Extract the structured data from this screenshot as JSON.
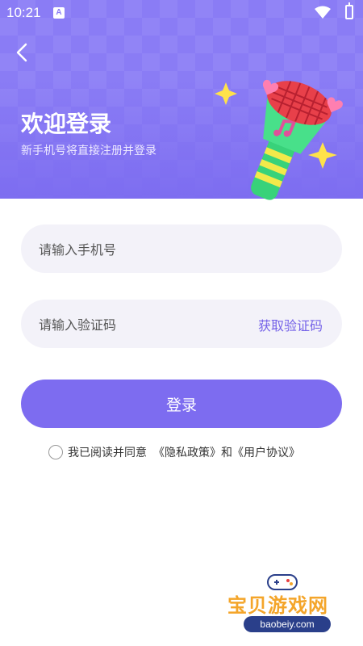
{
  "status_bar": {
    "time": "10:21",
    "notification_letter": "A"
  },
  "header": {
    "title": "欢迎登录",
    "subtitle": "新手机号将直接注册并登录"
  },
  "form": {
    "phone_placeholder": "请输入手机号",
    "code_placeholder": "请输入验证码",
    "get_code_label": "获取验证码",
    "login_label": "登录"
  },
  "agreement": {
    "prefix": "我已阅读并同意",
    "privacy_link": "《隐私政策》",
    "joiner": "和",
    "user_link": "《用户协议》"
  },
  "watermark": {
    "title": "宝贝游戏网",
    "url": "baobeiy.com"
  },
  "colors": {
    "primary": "#7d6cf0",
    "header": "#8a7cf5",
    "field_bg": "#f3f2f9",
    "link": "#7461e8"
  }
}
